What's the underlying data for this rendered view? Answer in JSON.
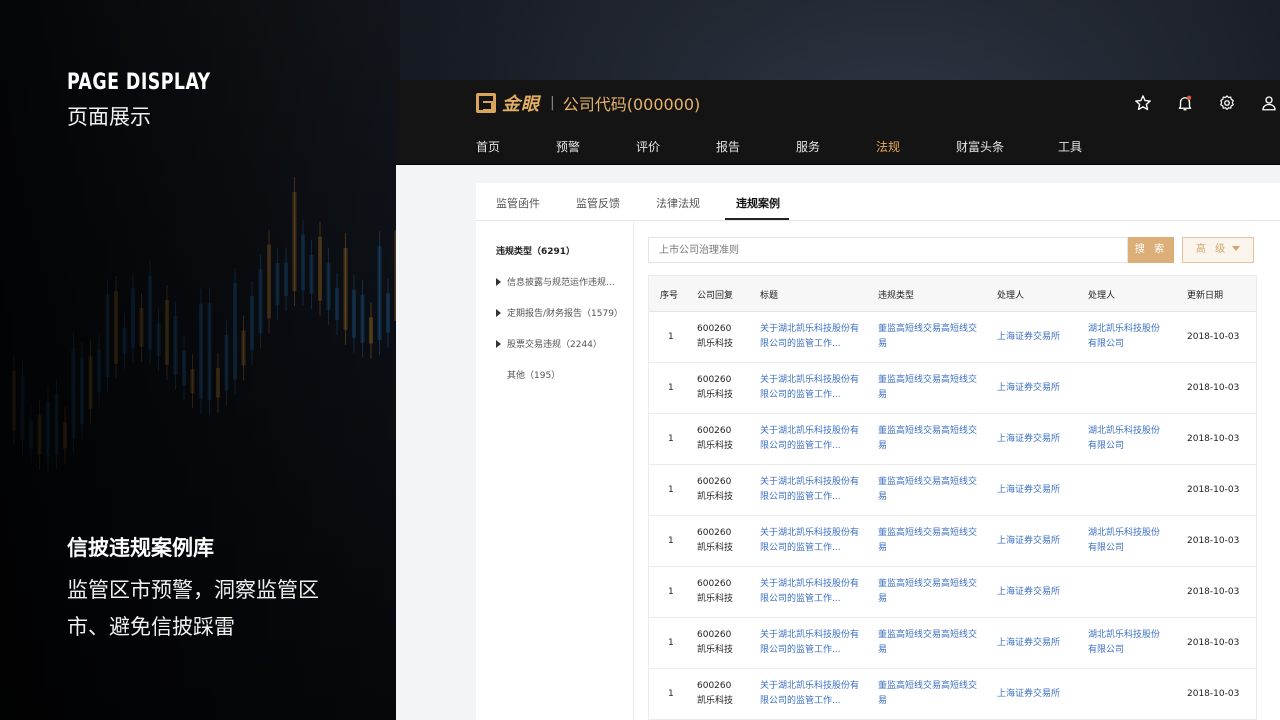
{
  "left_panel": {
    "heading_en": "PAGE DISPLAY",
    "heading_cn": "页面展示",
    "feature_title": "信披违规案例库",
    "feature_desc": "监管区市预警，洞察监管区市、避免信披踩雷"
  },
  "app": {
    "brand_name": "金眼",
    "company_code": "公司代码(000000)",
    "icons": [
      "star-icon",
      "bell-icon",
      "gear-icon",
      "user-icon"
    ],
    "nav": [
      {
        "label": "首页",
        "active": false
      },
      {
        "label": "预警",
        "active": false
      },
      {
        "label": "评价",
        "active": false
      },
      {
        "label": "报告",
        "active": false
      },
      {
        "label": "服务",
        "active": false
      },
      {
        "label": "法规",
        "active": true
      },
      {
        "label": "财富头条",
        "active": false
      },
      {
        "label": "工具",
        "active": false
      }
    ],
    "tabs": [
      {
        "label": "监管函件",
        "active": false
      },
      {
        "label": "监管反馈",
        "active": false
      },
      {
        "label": "法律法规",
        "active": false
      },
      {
        "label": "违规案例",
        "active": true
      }
    ],
    "sidebar": {
      "heading": "违规类型（6291）",
      "items": [
        {
          "label": "信息披露与规范运作违规...",
          "expandable": true
        },
        {
          "label": "定期报告/财务报告（1579）",
          "expandable": true
        },
        {
          "label": "股票交易违规（2244）",
          "expandable": true
        },
        {
          "label": "其他（195）",
          "expandable": false
        }
      ]
    },
    "search": {
      "placeholder": "上市公司治理准则",
      "search_label": "搜 索",
      "advanced_label": "高 级"
    },
    "table": {
      "columns": [
        "序号",
        "公司回复",
        "标题",
        "违规类型",
        "处理人",
        "处理人",
        "更新日期"
      ],
      "rows": [
        {
          "no": "1",
          "code": "600260",
          "name": "凯乐科技",
          "title": "关于湖北凯乐科技股份有限公司的监管工作...",
          "type": "董监高短线交易高短线交易",
          "org": "上海证券交易所",
          "person": "湖北凯乐科技股份有限公司",
          "date": "2018-10-03"
        },
        {
          "no": "1",
          "code": "600260",
          "name": "凯乐科技",
          "title": "关于湖北凯乐科技股份有限公司的监管工作...",
          "type": "董监高短线交易高短线交易",
          "org": "上海证券交易所",
          "person": "",
          "date": "2018-10-03"
        },
        {
          "no": "1",
          "code": "600260",
          "name": "凯乐科技",
          "title": "关于湖北凯乐科技股份有限公司的监管工作...",
          "type": "董监高短线交易高短线交易",
          "org": "上海证券交易所",
          "person": "湖北凯乐科技股份有限公司",
          "date": "2018-10-03"
        },
        {
          "no": "1",
          "code": "600260",
          "name": "凯乐科技",
          "title": "关于湖北凯乐科技股份有限公司的监管工作...",
          "type": "董监高短线交易高短线交易",
          "org": "上海证券交易所",
          "person": "",
          "date": "2018-10-03"
        },
        {
          "no": "1",
          "code": "600260",
          "name": "凯乐科技",
          "title": "关于湖北凯乐科技股份有限公司的监管工作...",
          "type": "董监高短线交易高短线交易",
          "org": "上海证券交易所",
          "person": "湖北凯乐科技股份有限公司",
          "date": "2018-10-03"
        },
        {
          "no": "1",
          "code": "600260",
          "name": "凯乐科技",
          "title": "关于湖北凯乐科技股份有限公司的监管工作...",
          "type": "董监高短线交易高短线交易",
          "org": "上海证券交易所",
          "person": "",
          "date": "2018-10-03"
        },
        {
          "no": "1",
          "code": "600260",
          "name": "凯乐科技",
          "title": "关于湖北凯乐科技股份有限公司的监管工作...",
          "type": "董监高短线交易高短线交易",
          "org": "上海证券交易所",
          "person": "湖北凯乐科技股份有限公司",
          "date": "2018-10-03"
        },
        {
          "no": "1",
          "code": "600260",
          "name": "凯乐科技",
          "title": "关于湖北凯乐科技股份有限公司的监管工作...",
          "type": "董监高短线交易高短线交易",
          "org": "上海证券交易所",
          "person": "",
          "date": "2018-10-03"
        }
      ]
    }
  },
  "colors": {
    "accent": "#dcae78",
    "nav_active": "#e7a85d",
    "link": "#3b6fc2",
    "topbar": "#141414"
  }
}
